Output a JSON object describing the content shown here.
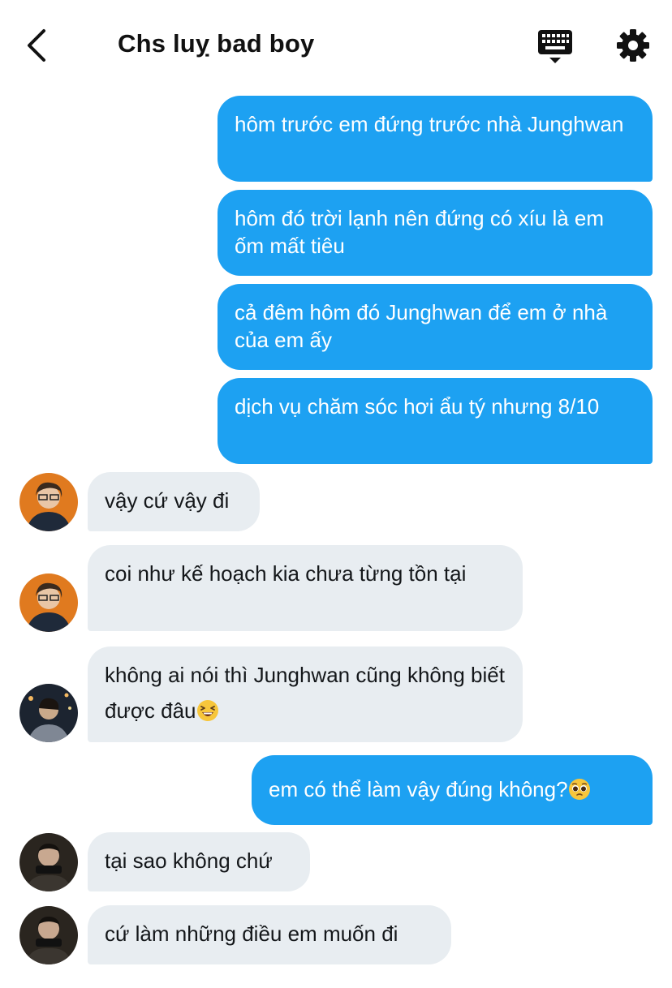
{
  "header": {
    "title": "Chs luỵ bad boy",
    "icons": {
      "back": "chevron-left-icon",
      "keyboard": "keyboard-icon",
      "settings": "gear-icon"
    }
  },
  "colors": {
    "outgoing": "#1da1f2",
    "incoming": "#e8edf1",
    "text": "#14171a"
  },
  "messages": [
    {
      "dir": "out",
      "text": "hôm trước em đứng trước nhà Junghwan"
    },
    {
      "dir": "out",
      "text": "hôm đó trời lạnh nên đứng có xíu là em ốm mất tiêu"
    },
    {
      "dir": "out",
      "text": "cả đêm hôm đó Junghwan để em ở nhà của em ấy"
    },
    {
      "dir": "out",
      "text": "dịch vụ chăm sóc hơi ẩu tý nhưng 8/10"
    },
    {
      "dir": "in",
      "text": "vậy cứ vậy đi",
      "avatar": "avatar-orange"
    },
    {
      "dir": "in",
      "text": "coi như kế hoạch kia chưa từng tồn tại",
      "avatar": "avatar-orange"
    },
    {
      "dir": "in",
      "text": "không ai nói thì Junghwan cũng không biết được đâu",
      "emoji": "grinning-squinting-face-emoji",
      "avatar": "avatar-night"
    },
    {
      "dir": "out",
      "text": "em có thể làm vậy đúng không?",
      "emoji": "pleading-face-emoji"
    },
    {
      "dir": "in",
      "text": "tại sao không chứ",
      "avatar": "avatar-dark"
    },
    {
      "dir": "in",
      "text": "cứ làm những điều em muốn đi",
      "avatar": "avatar-dark"
    }
  ]
}
